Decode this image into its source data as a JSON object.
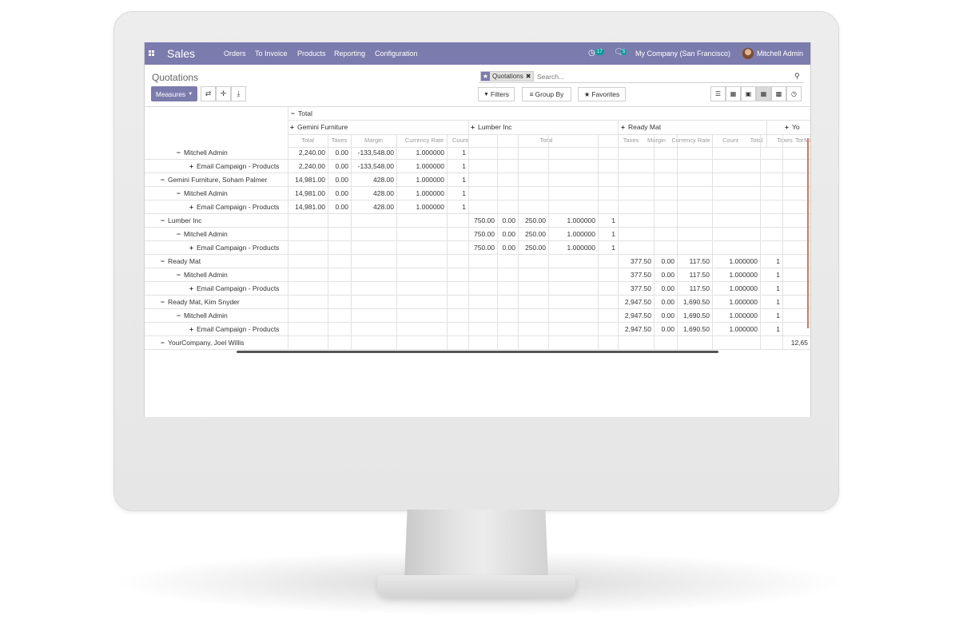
{
  "navbar": {
    "app_name": "Sales",
    "menu": [
      "Orders",
      "To Invoice",
      "Products",
      "Reporting",
      "Configuration"
    ],
    "activity_count": "17",
    "messages_count": "5",
    "company": "My Company (San Francisco)",
    "user": "Mitchell Admin"
  },
  "breadcrumb": "Quotations",
  "buttons": {
    "measures": "Measures",
    "filters": "Filters",
    "group_by": "Group By",
    "favorites": "Favorites"
  },
  "search": {
    "facet": "Quotations",
    "placeholder": "Search..."
  },
  "pivot": {
    "col_total": "Total",
    "col_groups": [
      "Gemini Furniture",
      "Lumber Inc",
      "Ready Mat",
      "Yo"
    ],
    "measures": [
      "Total",
      "Taxes",
      "Margin",
      "Currency Rate",
      "Count"
    ],
    "last_measure_partial": "Tot",
    "rows": [
      {
        "label": "Mitchell Admin",
        "sign": "−",
        "level": 1,
        "values": [
          "2,240.00",
          "0.00",
          "-133,548.00",
          "1.000000",
          "1",
          "",
          "",
          "",
          "",
          "",
          "",
          "",
          "",
          "",
          "",
          ""
        ]
      },
      {
        "label": "Email Campaign - Products",
        "sign": "+",
        "level": 2,
        "values": [
          "2,240.00",
          "0.00",
          "-133,548.00",
          "1.000000",
          "1",
          "",
          "",
          "",
          "",
          "",
          "",
          "",
          "",
          "",
          "",
          ""
        ]
      },
      {
        "label": "Gemini Furniture, Soham Palmer",
        "sign": "−",
        "level": 0,
        "values": [
          "14,981.00",
          "0.00",
          "428.00",
          "1.000000",
          "1",
          "",
          "",
          "",
          "",
          "",
          "",
          "",
          "",
          "",
          "",
          ""
        ]
      },
      {
        "label": "Mitchell Admin",
        "sign": "−",
        "level": 1,
        "values": [
          "14,981.00",
          "0.00",
          "428.00",
          "1.000000",
          "1",
          "",
          "",
          "",
          "",
          "",
          "",
          "",
          "",
          "",
          "",
          ""
        ]
      },
      {
        "label": "Email Campaign - Products",
        "sign": "+",
        "level": 2,
        "values": [
          "14,981.00",
          "0.00",
          "428.00",
          "1.000000",
          "1",
          "",
          "",
          "",
          "",
          "",
          "",
          "",
          "",
          "",
          "",
          ""
        ]
      },
      {
        "label": "Lumber Inc",
        "sign": "−",
        "level": 0,
        "values": [
          "",
          "",
          "",
          "",
          "",
          "750.00",
          "0.00",
          "250.00",
          "1.000000",
          "1",
          "",
          "",
          "",
          "",
          "",
          ""
        ]
      },
      {
        "label": "Mitchell Admin",
        "sign": "−",
        "level": 1,
        "values": [
          "",
          "",
          "",
          "",
          "",
          "750.00",
          "0.00",
          "250.00",
          "1.000000",
          "1",
          "",
          "",
          "",
          "",
          "",
          ""
        ]
      },
      {
        "label": "Email Campaign - Products",
        "sign": "+",
        "level": 2,
        "values": [
          "",
          "",
          "",
          "",
          "",
          "750.00",
          "0.00",
          "250.00",
          "1.000000",
          "1",
          "",
          "",
          "",
          "",
          "",
          ""
        ]
      },
      {
        "label": "Ready Mat",
        "sign": "−",
        "level": 0,
        "values": [
          "",
          "",
          "",
          "",
          "",
          "",
          "",
          "",
          "",
          "",
          "377.50",
          "0.00",
          "117.50",
          "1.000000",
          "1",
          ""
        ]
      },
      {
        "label": "Mitchell Admin",
        "sign": "−",
        "level": 1,
        "values": [
          "",
          "",
          "",
          "",
          "",
          "",
          "",
          "",
          "",
          "",
          "377.50",
          "0.00",
          "117.50",
          "1.000000",
          "1",
          ""
        ]
      },
      {
        "label": "Email Campaign - Products",
        "sign": "+",
        "level": 2,
        "values": [
          "",
          "",
          "",
          "",
          "",
          "",
          "",
          "",
          "",
          "",
          "377.50",
          "0.00",
          "117.50",
          "1.000000",
          "1",
          ""
        ]
      },
      {
        "label": "Ready Mat, Kim Snyder",
        "sign": "−",
        "level": 0,
        "values": [
          "",
          "",
          "",
          "",
          "",
          "",
          "",
          "",
          "",
          "",
          "2,947.50",
          "0.00",
          "1,690.50",
          "1.000000",
          "1",
          ""
        ]
      },
      {
        "label": "Mitchell Admin",
        "sign": "−",
        "level": 1,
        "values": [
          "",
          "",
          "",
          "",
          "",
          "",
          "",
          "",
          "",
          "",
          "2,947.50",
          "0.00",
          "1,690.50",
          "1.000000",
          "1",
          ""
        ]
      },
      {
        "label": "Email Campaign - Products",
        "sign": "+",
        "level": 2,
        "values": [
          "",
          "",
          "",
          "",
          "",
          "",
          "",
          "",
          "",
          "",
          "2,947.50",
          "0.00",
          "1,690.50",
          "1.000000",
          "1",
          ""
        ]
      },
      {
        "label": "YourCompany, Joel Willis",
        "sign": "−",
        "level": 0,
        "values": [
          "",
          "",
          "",
          "",
          "",
          "",
          "",
          "",
          "",
          "",
          "",
          "",
          "",
          "",
          "",
          "12,65"
        ]
      }
    ]
  },
  "colors": {
    "navbar": "#7c7bad",
    "badge": "#00a09d",
    "accent_edge": "#e86f5a"
  }
}
